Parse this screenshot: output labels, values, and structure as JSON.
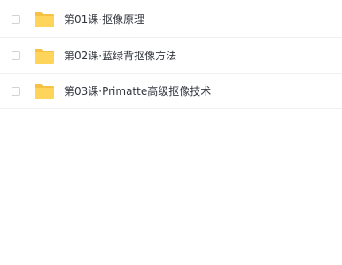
{
  "files": [
    {
      "name": "第01课·抠像原理",
      "type": "folder",
      "icon": "folder-icon",
      "checked": false
    },
    {
      "name": "第02课·蓝绿背抠像方法",
      "type": "folder",
      "icon": "folder-icon",
      "checked": false
    },
    {
      "name": "第03课·Primatte高级抠像技术",
      "type": "folder",
      "icon": "folder-icon",
      "checked": false
    }
  ],
  "colors": {
    "folder_body": "#FFD45B",
    "folder_tab": "#F7C244",
    "row_border": "#EEF0F3",
    "text": "#33373D"
  }
}
